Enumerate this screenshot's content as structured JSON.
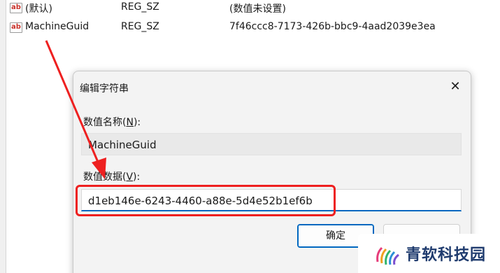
{
  "registry_rows": [
    {
      "icon": "ab",
      "name": "(默认)",
      "type": "REG_SZ",
      "data": "(数值未设置)"
    },
    {
      "icon": "ab",
      "name": "MachineGuid",
      "type": "REG_SZ",
      "data": "7f46ccc8-7173-426b-bbc9-4aad2039e3ea"
    }
  ],
  "dialog": {
    "title": "编辑字符串",
    "close_glyph": "✕",
    "name_label": "数值名称(",
    "name_label_key": "N",
    "name_label_end": "):",
    "name_value": "MachineGuid",
    "data_label": "数值数据(",
    "data_label_key": "V",
    "data_label_end": "):",
    "data_value": "d1eb146e-6243-4460-a88e-5d4e52b1ef6b",
    "ok_label": "确定",
    "cancel_label": ""
  },
  "annotation": {
    "color": "#ee2020"
  },
  "watermark": {
    "text": "青软科技园"
  },
  "colors": {
    "accent": "#0067c0",
    "highlight": "#ee2020",
    "watermark_text": "#1f3b6e"
  }
}
